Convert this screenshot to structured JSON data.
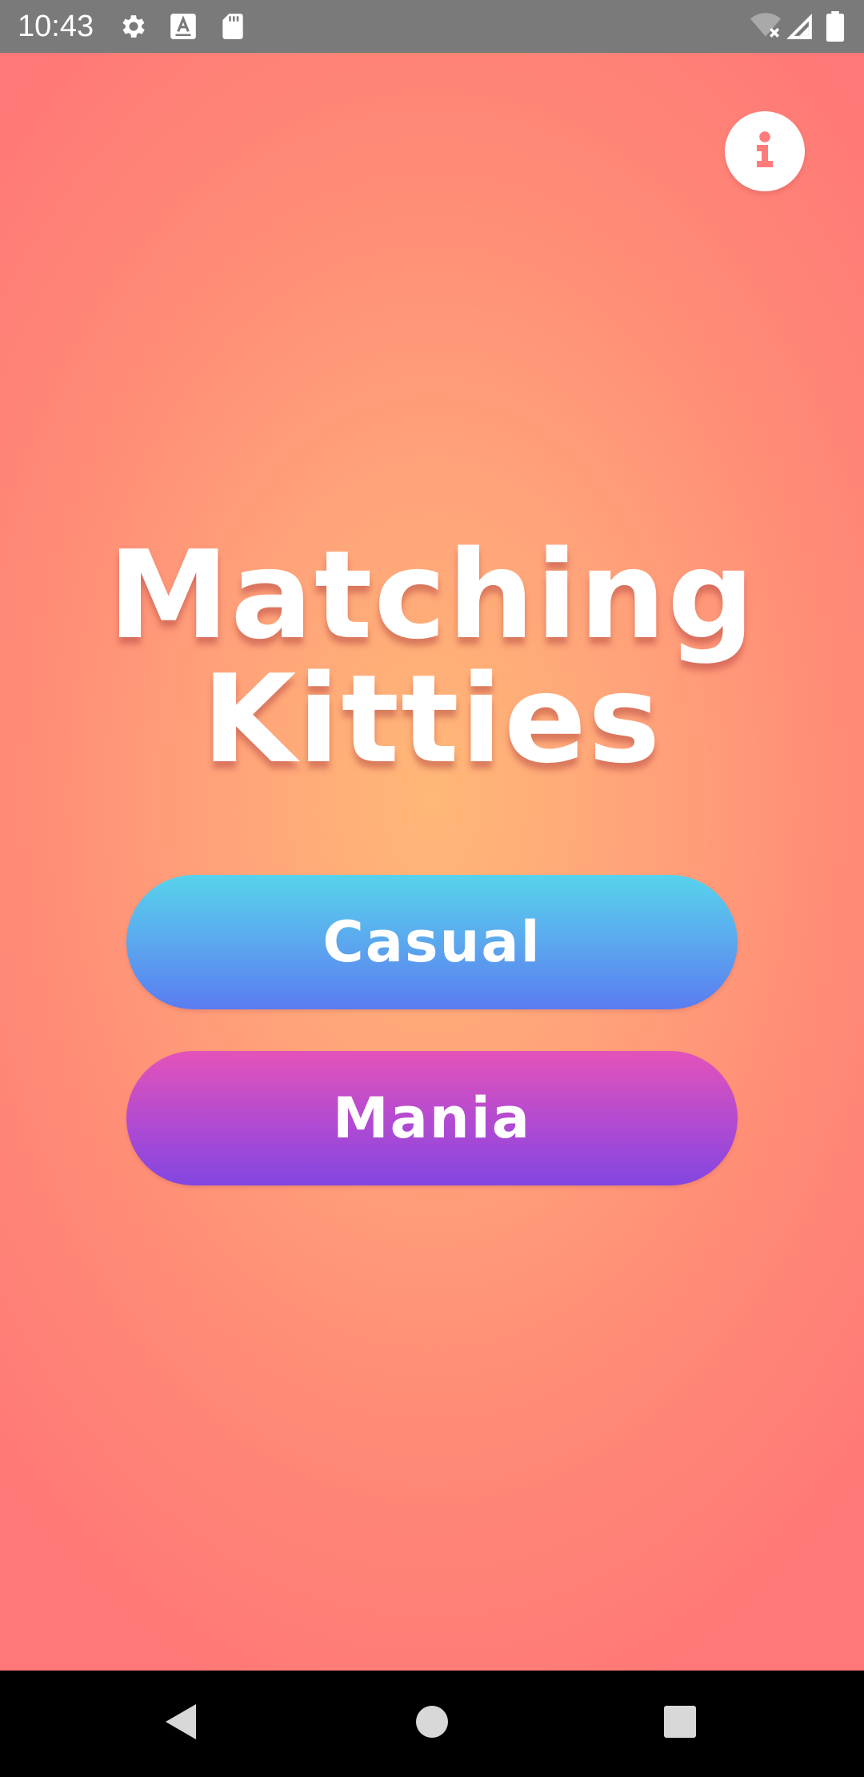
{
  "status_bar": {
    "time": "10:43",
    "icons": [
      "gear-icon",
      "keyboard-a-icon",
      "sd-card-icon",
      "wifi-off-icon",
      "cell-signal-icon",
      "battery-icon"
    ]
  },
  "app": {
    "title_line1": "Matching",
    "title_line2": "Kitties",
    "info_icon": "info-icon",
    "buttons": {
      "casual": "Casual",
      "mania": "Mania"
    },
    "colors": {
      "background_center": "#ffb877",
      "background_edge": "#ff7877",
      "casual_top": "#58d3ec",
      "casual_bottom": "#5a7cf0",
      "mania_top": "#e353b9",
      "mania_bottom": "#8246e0",
      "info_glyph": "#ff7a7a"
    }
  },
  "nav_bar": {
    "icons": [
      "back-icon",
      "home-icon",
      "recents-icon"
    ]
  }
}
